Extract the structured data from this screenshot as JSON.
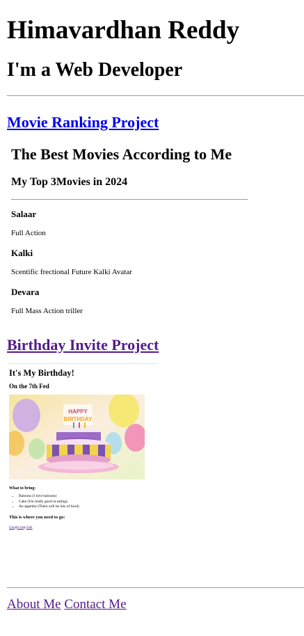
{
  "header": {
    "name": "Himavardhan Reddy",
    "role": "I'm a Web Developer"
  },
  "projects": {
    "movie": {
      "link_label": "Movie Ranking Project",
      "preview": {
        "title": "The Best Movies According to Me",
        "subtitle": "My Top 3Movies in 2024",
        "movies": [
          {
            "name": "Salaar",
            "desc": "Full Action"
          },
          {
            "name": "Kalki",
            "desc": "Scentific frectional Future Kalki Avatar"
          },
          {
            "name": "Devara",
            "desc": "Full Mass Action triller"
          }
        ]
      }
    },
    "birthday": {
      "link_label": "Birthday Invite Project",
      "preview": {
        "title": "It's My Birthday!",
        "date": "On the 7th Fed",
        "image_caption": "",
        "bring_heading": "What to bring:",
        "bring_items": [
          "Baloons (I love baloons)",
          "Cake (I'm really good at eating)",
          "An appetite (There will be lots of food)"
        ],
        "location_heading": "This is where you need to go:",
        "map_link": "Google map link"
      }
    }
  },
  "footer": {
    "about": "About Me",
    "contact": "Contact Me"
  },
  "colors": {
    "link_unvisited": "#0000ee",
    "link_visited": "#551a8b",
    "rule": "#9a9a9a"
  }
}
